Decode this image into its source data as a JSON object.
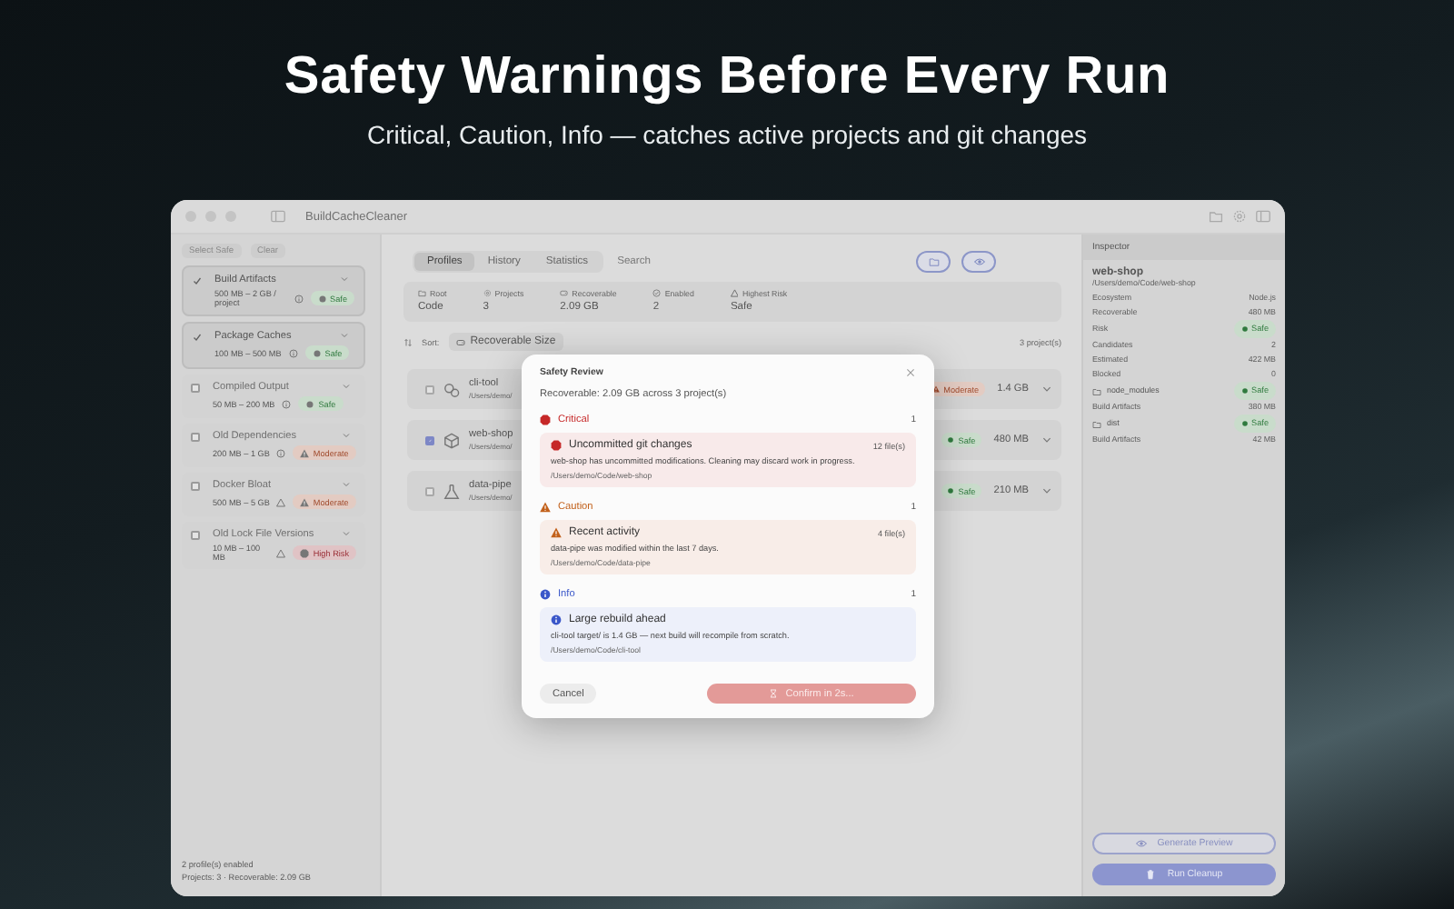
{
  "hero": {
    "title": "Safety Warnings Before Every Run",
    "subtitle": "Critical, Caution, Info — catches active projects and git changes"
  },
  "window": {
    "title": "BuildCacheCleaner"
  },
  "sidebar": {
    "buttons": [
      "Select Safe",
      "Clear"
    ],
    "profiles": [
      {
        "name": "Build Artifacts",
        "checked": true,
        "size": "500 MB – 2 GB / project",
        "kind": "safe",
        "risk_label": "Safe"
      },
      {
        "name": "Package Caches",
        "checked": true,
        "size": "100 MB – 500 MB",
        "kind": "safe",
        "risk_label": "Safe"
      },
      {
        "name": "Compiled Output",
        "checked": false,
        "size": "50 MB – 200 MB",
        "kind": "safe",
        "risk_label": "Safe"
      },
      {
        "name": "Old Dependencies",
        "checked": false,
        "size": "200 MB – 1 GB",
        "kind": "moderate",
        "risk_label": "Moderate"
      },
      {
        "name": "Docker Bloat",
        "checked": false,
        "size": "500 MB – 5 GB",
        "kind": "moderate",
        "risk_label": "Moderate"
      },
      {
        "name": "Old Lock File Versions",
        "checked": false,
        "size": "10 MB – 100 MB",
        "kind": "high",
        "risk_label": "High Risk"
      }
    ],
    "footer": [
      "2 profile(s) enabled",
      "Projects: 3 · Recoverable: 2.09 GB"
    ]
  },
  "tabs": [
    {
      "label": "Profiles",
      "selected": true
    },
    {
      "label": "History",
      "selected": false
    },
    {
      "label": "Statistics",
      "selected": false
    }
  ],
  "search": {
    "placeholder": "Search"
  },
  "stats": [
    {
      "label": "Root",
      "value": "Code"
    },
    {
      "label": "Projects",
      "value": "3"
    },
    {
      "label": "Recoverable",
      "value": "2.09 GB"
    },
    {
      "label": "Enabled",
      "value": "2"
    },
    {
      "label": "Highest Risk",
      "value": "Safe"
    }
  ],
  "sort": {
    "label": "Sort:",
    "value": "Recoverable Size",
    "count": "3 project(s)"
  },
  "projects": [
    {
      "name": "cli-tool",
      "path": "/Users/demo/",
      "checked": false,
      "kind": "moderate",
      "risk_label": "Moderate",
      "size": "1.4 GB"
    },
    {
      "name": "web-shop",
      "path": "/Users/demo/",
      "checked": true,
      "kind": "safe",
      "risk_label": "Safe",
      "size": "480 MB"
    },
    {
      "name": "data-pipe",
      "path": "/Users/demo/",
      "checked": false,
      "kind": "safe",
      "risk_label": "Safe",
      "size": "210 MB"
    }
  ],
  "inspector": {
    "title": "Inspector",
    "name": "web-shop",
    "path": "/Users/demo/Code/web-shop",
    "rows": [
      {
        "kind": "value",
        "label": "Ecosystem",
        "value": "Node.js"
      },
      {
        "kind": "value",
        "label": "Recoverable",
        "value": "480 MB"
      },
      {
        "kind": "badge",
        "label": "Risk",
        "value": "Safe"
      },
      {
        "kind": "value",
        "label": "Candidates",
        "value": "2"
      },
      {
        "kind": "value",
        "label": "Estimated",
        "value": "422 MB"
      },
      {
        "kind": "value",
        "label": "Blocked",
        "value": "0"
      },
      {
        "kind": "folder",
        "label": "node_modules",
        "value": "Safe"
      },
      {
        "kind": "value",
        "label": "Build Artifacts",
        "value": "380 MB"
      },
      {
        "kind": "folder",
        "label": "dist",
        "value": "Safe"
      },
      {
        "kind": "value",
        "label": "Build Artifacts",
        "value": "42 MB"
      }
    ],
    "buttons": [
      {
        "kind": "outline",
        "label": "Generate Preview"
      },
      {
        "kind": "filled",
        "label": "Run Cleanup"
      }
    ]
  },
  "modal": {
    "title": "Safety Review",
    "summary": "Recoverable: 2.09 GB across 3 project(s)",
    "sections": [
      {
        "kind": "critical",
        "label": "Critical",
        "count": "1",
        "items": [
          {
            "title": "Uncommitted git changes",
            "files": "12 file(s)",
            "text": "web-shop has uncommitted modifications. Cleaning may discard work in progress.",
            "path": "/Users/demo/Code/web-shop"
          }
        ]
      },
      {
        "kind": "caution",
        "label": "Caution",
        "count": "1",
        "items": [
          {
            "title": "Recent activity",
            "files": "4 file(s)",
            "text": "data-pipe was modified within the last 7 days.",
            "path": "/Users/demo/Code/data-pipe"
          }
        ]
      },
      {
        "kind": "info",
        "label": "Info",
        "count": "1",
        "items": [
          {
            "title": "Large rebuild ahead",
            "text": "cli-tool target/ is 1.4 GB — next build will recompile from scratch.",
            "path": "/Users/demo/Code/cli-tool"
          }
        ]
      }
    ],
    "cancel": "Cancel",
    "confirm": {
      "label": "Confirm in 2s...",
      "disabled": true
    }
  }
}
